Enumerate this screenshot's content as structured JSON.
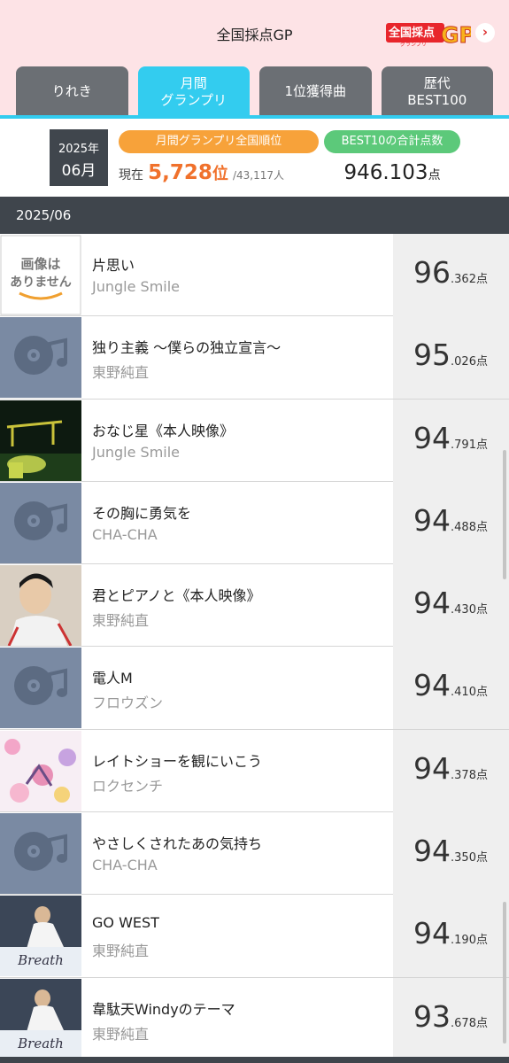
{
  "header": {
    "title": "全国採点GP",
    "logo_text": "全国採点",
    "logo_gp": "GP",
    "logo_sub": "グランプリ",
    "arrow": "›"
  },
  "tabs": [
    {
      "label": "りれき",
      "active": false
    },
    {
      "label": "月間\nグランプリ",
      "active": true
    },
    {
      "label": "1位獲得曲",
      "active": false
    },
    {
      "label": "歴代\nBEST100",
      "active": false
    }
  ],
  "summary": {
    "year": "2025年",
    "month": "06月",
    "rank_pill": "月間グランプリ全国順位",
    "best_pill": "BEST10の合計点数",
    "rank_prefix": "現在",
    "rank_value": "5,728",
    "rank_unit": "位",
    "rank_total": "/43,117人",
    "total_value": "946.103",
    "total_unit": "点"
  },
  "month_label": "2025/06",
  "score_unit": "点",
  "songs": [
    {
      "title": "片思い",
      "artist": "Jungle Smile",
      "score_int": "96",
      "score_dec": ".362",
      "thumb": "no-image"
    },
    {
      "title": "独り主義 〜僕らの独立宣言〜",
      "artist": "東野純直",
      "score_int": "95",
      "score_dec": ".026",
      "thumb": "music-placeholder"
    },
    {
      "title": "おなじ星《本人映像》",
      "artist": "Jungle Smile",
      "score_int": "94",
      "score_dec": ".791",
      "thumb": "night-photo"
    },
    {
      "title": "その胸に勇気を",
      "artist": "CHA-CHA",
      "score_int": "94",
      "score_dec": ".488",
      "thumb": "music-placeholder"
    },
    {
      "title": "君とピアノと《本人映像》",
      "artist": "東野純直",
      "score_int": "94",
      "score_dec": ".430",
      "thumb": "portrait-photo"
    },
    {
      "title": "電人M",
      "artist": "フロウズン",
      "score_int": "94",
      "score_dec": ".410",
      "thumb": "music-placeholder"
    },
    {
      "title": "レイトショーを観にいこう",
      "artist": "ロクセンチ",
      "score_int": "94",
      "score_dec": ".378",
      "thumb": "flower-art"
    },
    {
      "title": "やさしくされたあの気持ち",
      "artist": "CHA-CHA",
      "score_int": "94",
      "score_dec": ".350",
      "thumb": "music-placeholder"
    },
    {
      "title": "GO WEST",
      "artist": "東野純直",
      "score_int": "94",
      "score_dec": ".190",
      "thumb": "breath-cover"
    },
    {
      "title": "韋駄天Windyのテーマ",
      "artist": "東野純直",
      "score_int": "93",
      "score_dec": ".678",
      "thumb": "breath-cover"
    }
  ],
  "no_image_text": [
    "画像は",
    "ありません"
  ],
  "breath_text": "Breath",
  "colors": {
    "header_bg": "#fde3e6",
    "tab_active": "#33ccef",
    "tab_inactive": "#6b6f74",
    "rank_orange": "#f7a23a",
    "best_green": "#5cc97a",
    "rank_value": "#f0712c",
    "dark_bar": "#3f454c"
  }
}
